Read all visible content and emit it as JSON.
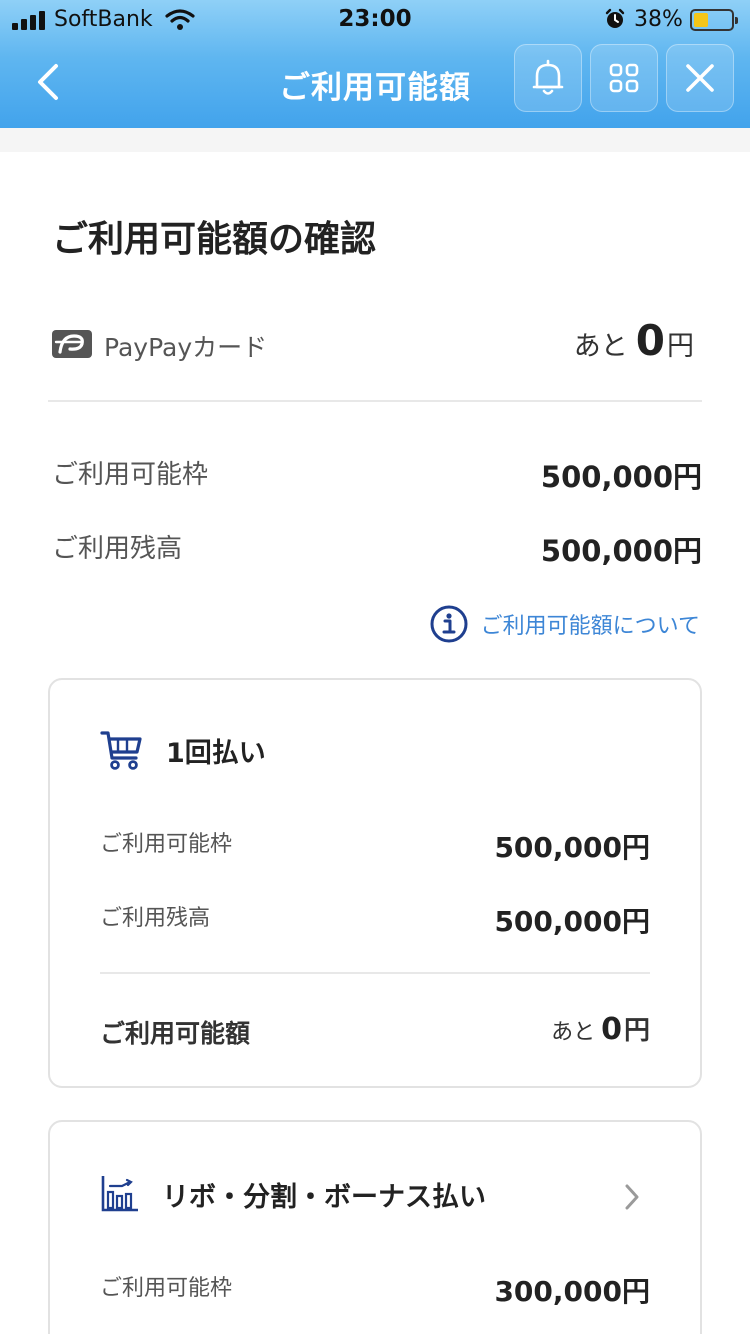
{
  "status_bar": {
    "carrier": "SoftBank",
    "time": "23:00",
    "battery_percent": "38%",
    "battery_level": 0.38
  },
  "nav": {
    "title": "ご利用可能額",
    "icons": [
      "back-chevron-icon",
      "bell-icon",
      "grid-menu-icon",
      "close-icon"
    ]
  },
  "page": {
    "heading": "ご利用可能額の確認",
    "card_name": "PayPayカード",
    "remaining_prefix": "あと",
    "remaining_amount": "0",
    "remaining_suffix": "円",
    "summary": [
      {
        "label": "ご利用可能枠",
        "value": "500,000円"
      },
      {
        "label": "ご利用残高",
        "value": "500,000円"
      }
    ],
    "about_link": "ご利用可能額について"
  },
  "lump_sum": {
    "title": "1回払い",
    "rows": [
      {
        "label": "ご利用可能枠",
        "value": "500,000円"
      },
      {
        "label": "ご利用残高",
        "value": "500,000円"
      }
    ],
    "total_label": "ご利用可能額",
    "total_prefix": "あと",
    "total_amount": "0",
    "total_suffix": "円"
  },
  "revolving": {
    "title": "リボ・分割・ボーナス払い",
    "rows": [
      {
        "label": "ご利用可能枠",
        "value": "300,000円"
      }
    ]
  },
  "colors": {
    "header_gradient_top": "#8fd0f7",
    "header_gradient_bottom": "#42a3ec",
    "link_blue": "#3d86d6",
    "icon_navy": "#1f3f8f"
  }
}
